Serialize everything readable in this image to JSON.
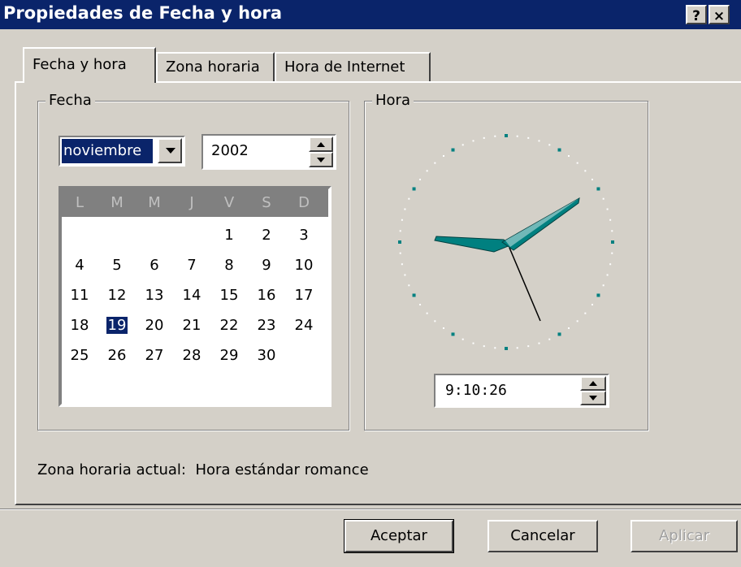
{
  "window": {
    "title": "Propiedades de Fecha y hora",
    "help_label": "?",
    "close_label": "×"
  },
  "tabs": [
    {
      "label": "Fecha y hora",
      "active": true
    },
    {
      "label": "Zona horaria",
      "active": false
    },
    {
      "label": "Hora de Internet",
      "active": false
    }
  ],
  "date": {
    "group_label": "Fecha",
    "month": "noviembre",
    "year": "2002",
    "weekday_headers": [
      "L",
      "M",
      "M",
      "J",
      "V",
      "S",
      "D"
    ],
    "days": [
      "1",
      "2",
      "3",
      "4",
      "5",
      "6",
      "7",
      "8",
      "9",
      "10",
      "11",
      "12",
      "13",
      "14",
      "15",
      "16",
      "17",
      "18",
      "19",
      "20",
      "21",
      "22",
      "23",
      "24",
      "25",
      "26",
      "27",
      "28",
      "29",
      "30"
    ],
    "first_weekday_index": 4,
    "selected_day": "19"
  },
  "time": {
    "group_label": "Hora",
    "value": "9:10:26"
  },
  "timezone": {
    "label": "Zona horaria actual:",
    "value": "Hora estándar romance"
  },
  "buttons": {
    "ok": "Aceptar",
    "cancel": "Cancelar",
    "apply": "Aplicar"
  },
  "colors": {
    "titlebar": "#0a246a",
    "face": "#d4d0c8",
    "clock_hands": "#008080",
    "selection": "#0a246a"
  }
}
